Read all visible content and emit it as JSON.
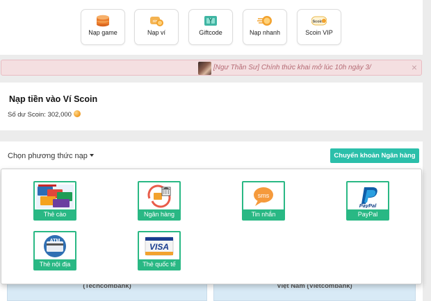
{
  "quick_nav": [
    {
      "label": "Nạp game",
      "icon": "coin-stack-icon"
    },
    {
      "label": "Nạp ví",
      "icon": "wallet-coin-icon"
    },
    {
      "label": "Giftcode",
      "icon": "gift-card-icon"
    },
    {
      "label": "Nạp nhanh",
      "icon": "fast-coin-icon"
    },
    {
      "label": "Scoin VIP",
      "icon": "scoin-vip-icon"
    }
  ],
  "notice": {
    "text": "[Ngư Thần Sư] Chính thức khai mở lúc 10h ngày 3/",
    "close": "×"
  },
  "wallet": {
    "title": "Nạp tiền vào Ví Scoin",
    "balance_label": "Số dư Scoin: 302,000"
  },
  "method": {
    "choose_label": "Chọn phương thức nạp",
    "bank_transfer_button": "Chuyển khoản Ngân hàng"
  },
  "payment_options": [
    {
      "label": "Thẻ cào",
      "icon": "scratch-card-icon"
    },
    {
      "label": "Ngân hàng",
      "icon": "bank-icon"
    },
    {
      "label": "Tin nhắn",
      "icon": "sms-icon"
    },
    {
      "label": "PayPal",
      "icon": "paypal-icon",
      "logo_text": "PayPal"
    },
    {
      "label": "Thẻ nội địa",
      "icon": "atm-card-icon",
      "logo_text": "ATM"
    },
    {
      "label": "Thẻ quốc tế",
      "icon": "visa-card-icon",
      "logo_text": "VISA"
    }
  ],
  "banks": [
    {
      "name": "(Techcombank)"
    },
    {
      "name": "Việt Nam (Vietcombank)"
    }
  ],
  "colors": {
    "accent_green": "#29b884",
    "bank_button": "#2bbfaa",
    "notice_bg": "#f4dfe1",
    "notice_text": "#b56a74"
  }
}
